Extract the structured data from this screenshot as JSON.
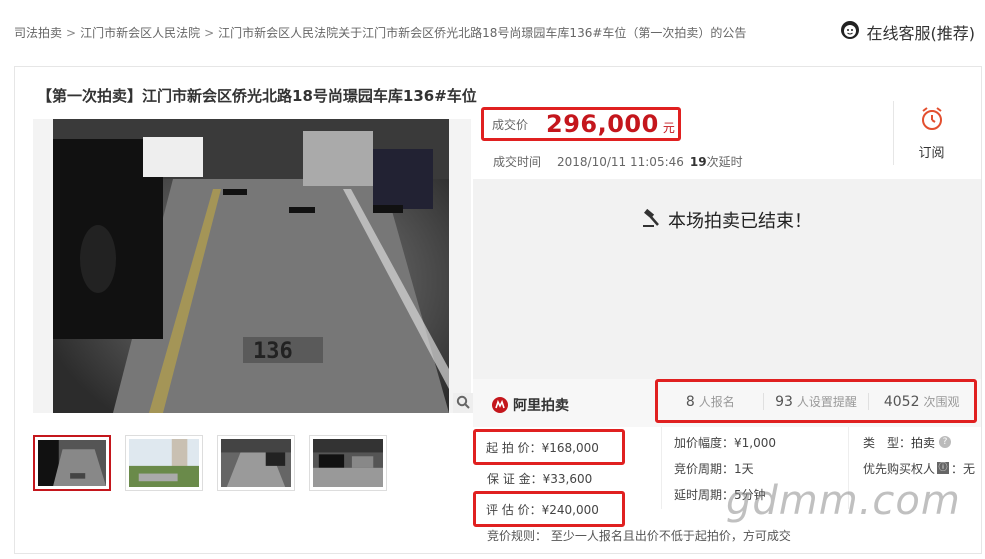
{
  "breadcrumb": {
    "items": [
      "司法拍卖",
      "江门市新会区人民法院",
      "江门市新会区人民法院关于江门市新会区侨光北路18号尚璟园车库136#车位（第一次拍卖）的公告"
    ],
    "separator": ">"
  },
  "service": {
    "label": "在线客服(推荐)",
    "icon": "customer-service-icon"
  },
  "item": {
    "title": "【第一次拍卖】江门市新会区侨光北路18号尚璟园车库136#车位"
  },
  "deal": {
    "label": "成交价",
    "price": "296,000",
    "unit": "元",
    "time_label": "成交时间",
    "time_value": "2018/10/11 11:05:46",
    "delay_count": "19",
    "delay_label": "次延时"
  },
  "subscribe": {
    "label": "订阅",
    "icon": "alarm-clock-icon"
  },
  "status": {
    "ended_text": "本场拍卖已结束！",
    "icon": "gavel-icon"
  },
  "platform": {
    "name": "阿里拍卖",
    "icon": "ali-auction-logo"
  },
  "stats": [
    {
      "value": "8",
      "label": "人报名"
    },
    {
      "value": "93",
      "label": "人设置提醒"
    },
    {
      "value": "4052",
      "label": "次围观"
    }
  ],
  "terms": {
    "start_price": "起 拍 价：¥168,000",
    "deposit": "保 证 金：¥33,600",
    "appraisal": "评 估 价：¥240,000",
    "increment": "加价幅度：¥1,000",
    "cycle": "竞价周期：1天",
    "delay": "延时周期：5分钟",
    "type_label": "类　型：",
    "type_value": "拍卖",
    "priority_label": "优先购买权人",
    "priority_badge": "ⓘ",
    "priority_value": "：无",
    "rules": "竞价规则： 至少一人报名且出价不低于起拍价，方可成交"
  },
  "watermark": "gdmm.com",
  "colors": {
    "accent": "#c4161c",
    "highlight_border": "#e02020"
  }
}
